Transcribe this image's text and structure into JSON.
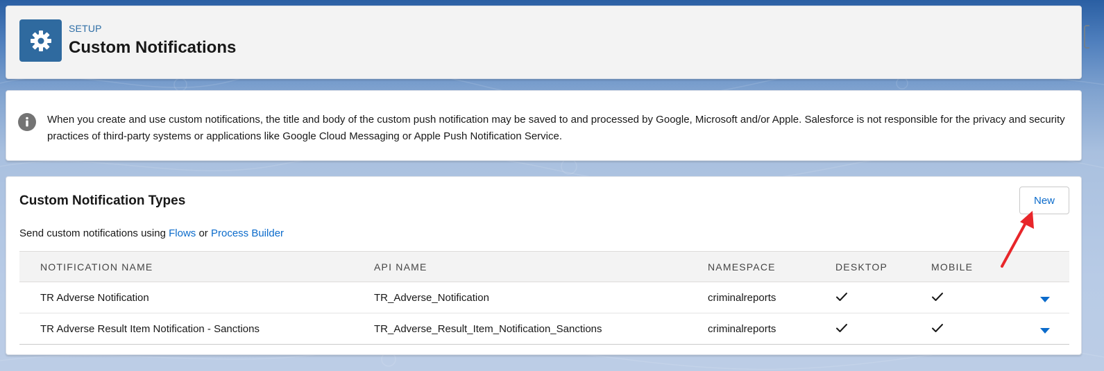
{
  "header": {
    "eyebrow": "SETUP",
    "title": "Custom Notifications",
    "icon": "gear-icon"
  },
  "info": {
    "icon": "info-icon",
    "text": "When you create and use custom notifications, the title and body of the custom push notification may be saved to and processed by Google, Microsoft and/or Apple. Salesforce is not responsible for the privacy and security practices of third-party systems or applications like Google Cloud Messaging or Apple Push Notification Service."
  },
  "types": {
    "title": "Custom Notification Types",
    "new_label": "New",
    "sub_prefix": "Send custom notifications using ",
    "flows_link": "Flows",
    "sub_or": " or ",
    "process_builder_link": "Process Builder",
    "columns": [
      "NOTIFICATION NAME",
      "API NAME",
      "NAMESPACE",
      "DESKTOP",
      "MOBILE"
    ],
    "rows": [
      {
        "name": "TR Adverse Notification",
        "api_name": "TR_Adverse_Notification",
        "namespace": "criminalreports",
        "desktop": true,
        "mobile": true
      },
      {
        "name": "TR Adverse Result Item Notification - Sanctions",
        "api_name": "TR_Adverse_Result_Item_Notification_Sanctions",
        "namespace": "criminalreports",
        "desktop": true,
        "mobile": true
      }
    ]
  },
  "colors": {
    "brand_icon": "#2f6a9f",
    "link": "#0b6bcb",
    "annotation_arrow": "#e8262a"
  }
}
